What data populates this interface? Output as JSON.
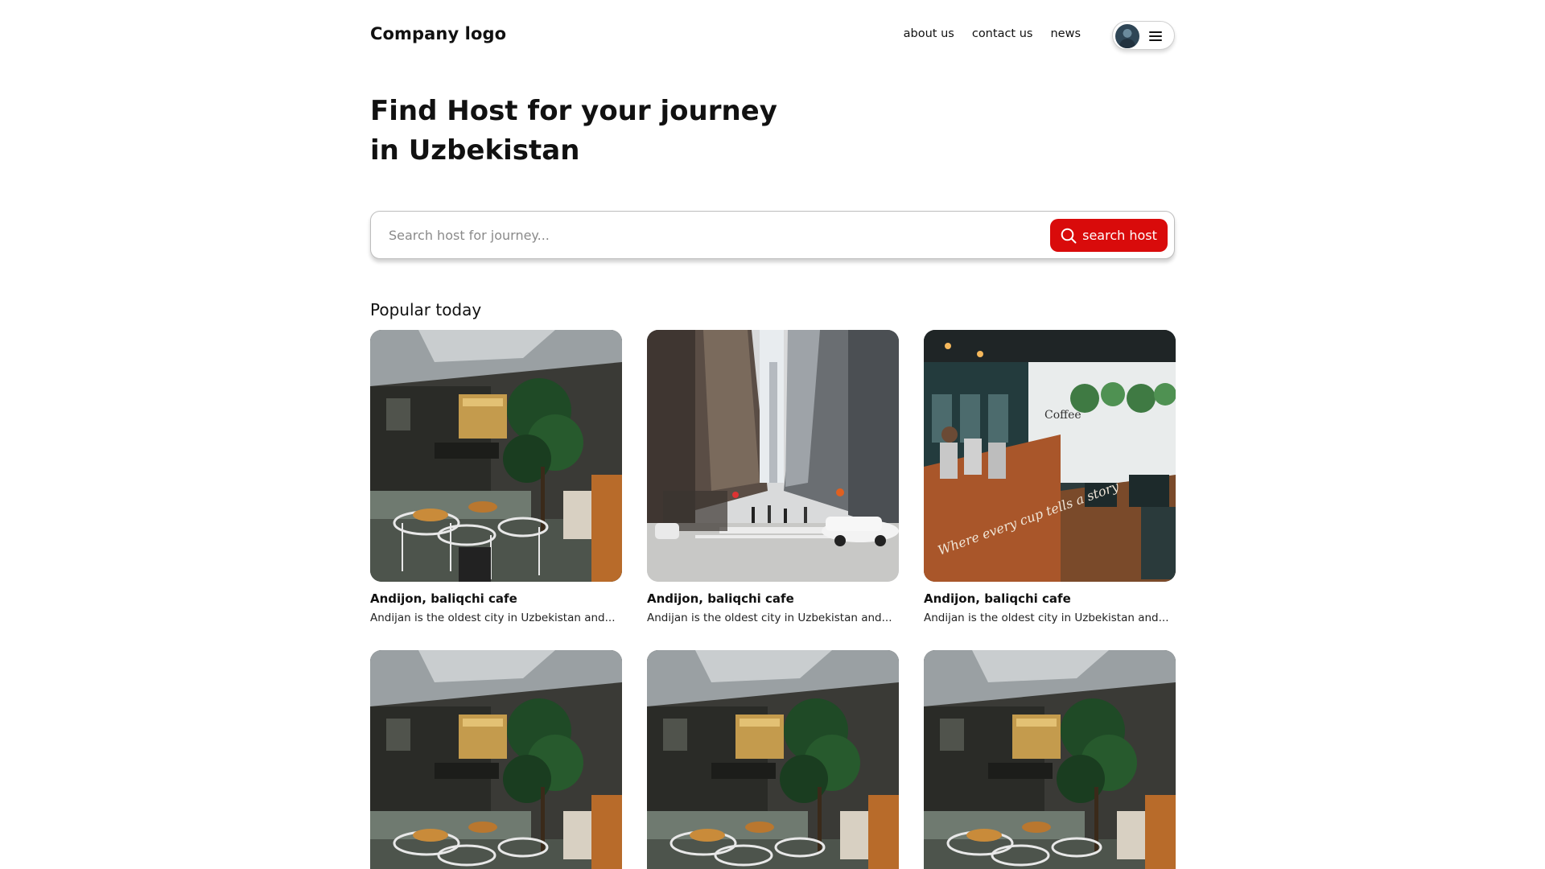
{
  "header": {
    "logo": "Company logo",
    "nav": [
      "about us",
      "contact us",
      "news"
    ]
  },
  "hero": {
    "title": "Find Host for your journey in Uzbekistan"
  },
  "search": {
    "placeholder": "Search host for journey...",
    "button_label": "search host",
    "button_color": "#d90b0b"
  },
  "popular": {
    "title": "Popular today",
    "cards": [
      {
        "image": "cafe-interior-photo",
        "title": "Andijon, baliqchi cafe",
        "desc": "Andijan is the oldest city in Uzbekistan and..."
      },
      {
        "image": "city-street-photo",
        "title": "Andijon, baliqchi cafe",
        "desc": "Andijan is the oldest city in Uzbekistan and..."
      },
      {
        "image": "coffee-bar-photo",
        "title": "Andijon, baliqchi cafe",
        "desc": "Andijan is the oldest city in Uzbekistan and..."
      },
      {
        "image": "cafe-interior-photo",
        "title": "",
        "desc": ""
      },
      {
        "image": "cafe-interior-photo",
        "title": "",
        "desc": ""
      },
      {
        "image": "cafe-interior-photo",
        "title": "",
        "desc": ""
      }
    ]
  }
}
